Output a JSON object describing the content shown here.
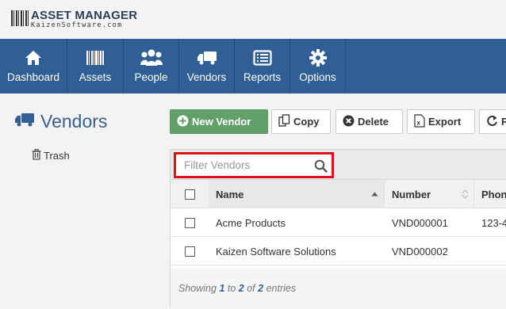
{
  "app": {
    "logo_title": "ASSET MANAGER",
    "logo_sub": "KaizenSoftware.com"
  },
  "nav": {
    "items": [
      {
        "label": "Dashboard",
        "icon": "home-icon"
      },
      {
        "label": "Assets",
        "icon": "barcode-icon"
      },
      {
        "label": "People",
        "icon": "people-icon"
      },
      {
        "label": "Vendors",
        "icon": "truck-icon"
      },
      {
        "label": "Reports",
        "icon": "list-icon"
      },
      {
        "label": "Options",
        "icon": "gear-icon"
      }
    ]
  },
  "sidebar": {
    "title": "Vendors",
    "trash_label": "Trash"
  },
  "toolbar": {
    "new_label": "New Vendor",
    "copy_label": "Copy",
    "delete_label": "Delete",
    "export_label": "Export",
    "refresh_label": "R"
  },
  "filter": {
    "placeholder": "Filter Vendors",
    "value": ""
  },
  "table": {
    "columns": [
      "Name",
      "Number",
      "Phone"
    ],
    "rows": [
      {
        "name": "Acme Products",
        "number": "VND000001",
        "phone": "123-4"
      },
      {
        "name": "Kaizen Software Solutions",
        "number": "VND000002",
        "phone": ""
      }
    ]
  },
  "footer": {
    "prefix": "Showing",
    "from": "1",
    "to_word": "to",
    "to": "2",
    "of_word": "of",
    "total": "2",
    "suffix": "entries"
  },
  "colors": {
    "nav_bg": "#2f5f94",
    "new_button": "#62a06a",
    "highlight": "#e0101a"
  }
}
